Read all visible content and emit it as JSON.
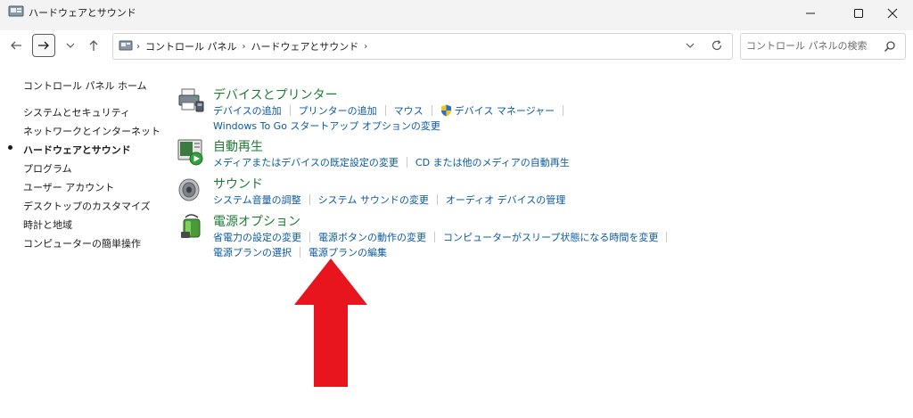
{
  "window": {
    "title": "ハードウェアとサウンド"
  },
  "address": {
    "crumbs": [
      "コントロール パネル",
      "ハードウェアとサウンド"
    ]
  },
  "search": {
    "placeholder": "コントロール パネルの検索"
  },
  "sidebar": {
    "home": "コントロール パネル ホーム",
    "items": [
      {
        "label": "システムとセキュリティ"
      },
      {
        "label": "ネットワークとインターネット"
      },
      {
        "label": "ハードウェアとサウンド"
      },
      {
        "label": "プログラム"
      },
      {
        "label": "ユーザー アカウント"
      },
      {
        "label": "デスクトップのカスタマイズ"
      },
      {
        "label": "時計と地域"
      },
      {
        "label": "コンピューターの簡単操作"
      }
    ]
  },
  "categories": [
    {
      "title": "デバイスとプリンター",
      "links": [
        "デバイスの追加",
        "プリンターの追加",
        "マウス",
        "デバイス マネージャー",
        "Windows To Go スタートアップ オプションの変更"
      ]
    },
    {
      "title": "自動再生",
      "links": [
        "メディアまたはデバイスの既定設定の変更",
        "CD または他のメディアの自動再生"
      ]
    },
    {
      "title": "サウンド",
      "links": [
        "システム音量の調整",
        "システム サウンドの変更",
        "オーディオ デバイスの管理"
      ]
    },
    {
      "title": "電源オプション",
      "links": [
        "省電力の設定の変更",
        "電源ボタンの動作の変更",
        "コンピューターがスリープ状態になる時間を変更",
        "電源プランの選択",
        "電源プランの編集"
      ]
    }
  ],
  "colors": {
    "category_title": "#1e7b34",
    "link": "#0a5aa8",
    "annotation_arrow": "#e8141e"
  }
}
